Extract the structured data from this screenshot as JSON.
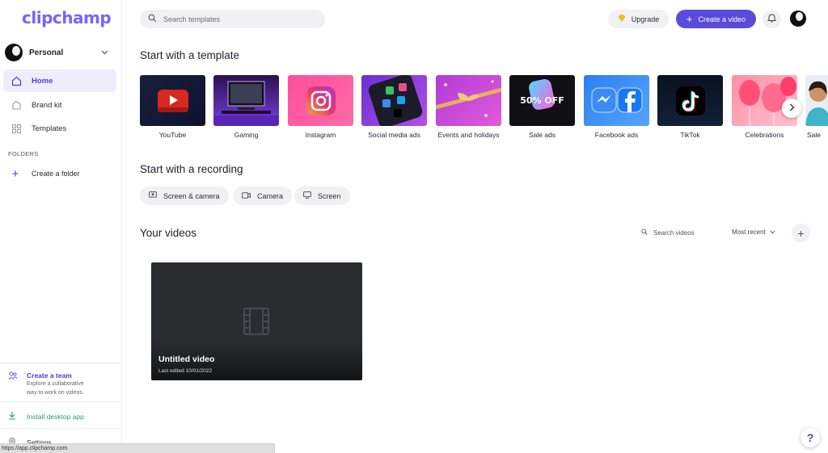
{
  "app": {
    "logo": "clipchamp",
    "brand_color": "#7b61ff",
    "accent_color": "#5a4bdc"
  },
  "sidebar": {
    "workspace": "Personal",
    "nav": [
      {
        "label": "Home",
        "icon": "home-icon",
        "active": true
      },
      {
        "label": "Brand kit",
        "icon": "brand-kit-icon",
        "active": false
      },
      {
        "label": "Templates",
        "icon": "templates-icon",
        "active": false
      }
    ],
    "folders_title": "FOLDERS",
    "create_folder": "Create a folder",
    "team": {
      "title": "Create a team",
      "line1": "Explore a collaborative",
      "line2": "way to work on videos."
    },
    "install": "Install desktop app",
    "settings": "Settings"
  },
  "status_url": "https://app.clipchamp.com",
  "topbar": {
    "search_placeholder": "Search templates",
    "upgrade": "Upgrade",
    "create": "Create a video"
  },
  "templates_section": {
    "title": "Start with a template",
    "items": [
      {
        "label": "YouTube"
      },
      {
        "label": "Gaming"
      },
      {
        "label": "Instagram"
      },
      {
        "label": "Social media ads"
      },
      {
        "label": "Events and holidays"
      },
      {
        "label": "Sale ads",
        "thumb_text": "50% OFF"
      },
      {
        "label": "Facebook ads"
      },
      {
        "label": "TikTok"
      },
      {
        "label": "Celebrations"
      },
      {
        "label": "Sale"
      }
    ]
  },
  "recording_section": {
    "title": "Start with a recording",
    "options": [
      {
        "label": "Screen & camera",
        "icon": "screen-camera-icon"
      },
      {
        "label": "Camera",
        "icon": "camera-icon"
      },
      {
        "label": "Screen",
        "icon": "screen-icon"
      }
    ]
  },
  "videos_section": {
    "title": "Your videos",
    "search": "Search videos",
    "sort": "Most recent",
    "videos": [
      {
        "title": "Untitled video",
        "meta": "Last edited 10/01/2022"
      }
    ]
  },
  "help": "?"
}
